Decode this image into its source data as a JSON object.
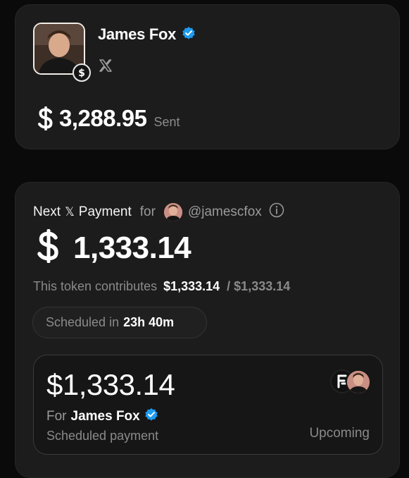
{
  "profile": {
    "name": "James Fox",
    "verified": true,
    "platform_icon": "x-logo-icon",
    "sent_amount": "3,288.95",
    "sent_label": "Sent"
  },
  "next_payment": {
    "prefix": "Next",
    "platform_symbol": "𝕏",
    "payment_label": "Payment",
    "for_label": "for",
    "handle": "@jamescfox",
    "amount": "1,333.14",
    "contrib_label": "This token contributes",
    "contrib_value": "$1,333.14",
    "contrib_total": "/ $1,333.14",
    "scheduled_label": "Scheduled in",
    "scheduled_value": "23h 40m"
  },
  "scheduled_card": {
    "amount": "$1,333.14",
    "for_label": "For",
    "recipient": "James Fox",
    "subtitle": "Scheduled payment",
    "status": "Upcoming"
  },
  "colors": {
    "background": "#0a0a0a",
    "card": "#1c1c1c",
    "verified_blue": "#1d9bf0",
    "muted_text": "#8a8a8a"
  }
}
